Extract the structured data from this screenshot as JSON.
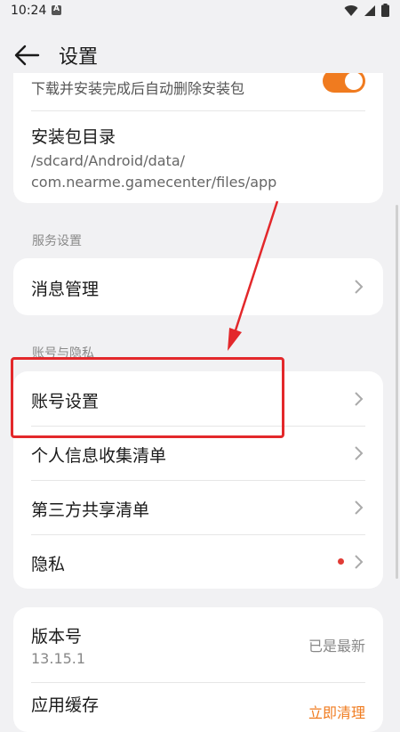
{
  "status": {
    "time": "10:24"
  },
  "header": {
    "title": "设置"
  },
  "install": {
    "auto_delete_desc": "下载并安装完成后自动删除安装包",
    "auto_delete_on": true,
    "dir_title": "安装包目录",
    "dir_path_line1": "/sdcard/Android/data/",
    "dir_path_line2": "com.nearme.gamecenter/files/app"
  },
  "service": {
    "section_label": "服务设置",
    "message_mgmt": "消息管理"
  },
  "account": {
    "section_label": "账号与隐私",
    "items": [
      {
        "label": "账号设置"
      },
      {
        "label": "个人信息收集清单"
      },
      {
        "label": "第三方共享清单"
      },
      {
        "label": "隐私",
        "has_red_dot": true
      }
    ]
  },
  "about": {
    "version_title": "版本号",
    "version_value": "13.15.1",
    "version_status": "已是最新",
    "cache_title": "应用缓存",
    "cache_action": "立即清理"
  },
  "colors": {
    "accent": "#f07b1f",
    "annotation": "#e3282b",
    "dot": "#e13b35"
  }
}
